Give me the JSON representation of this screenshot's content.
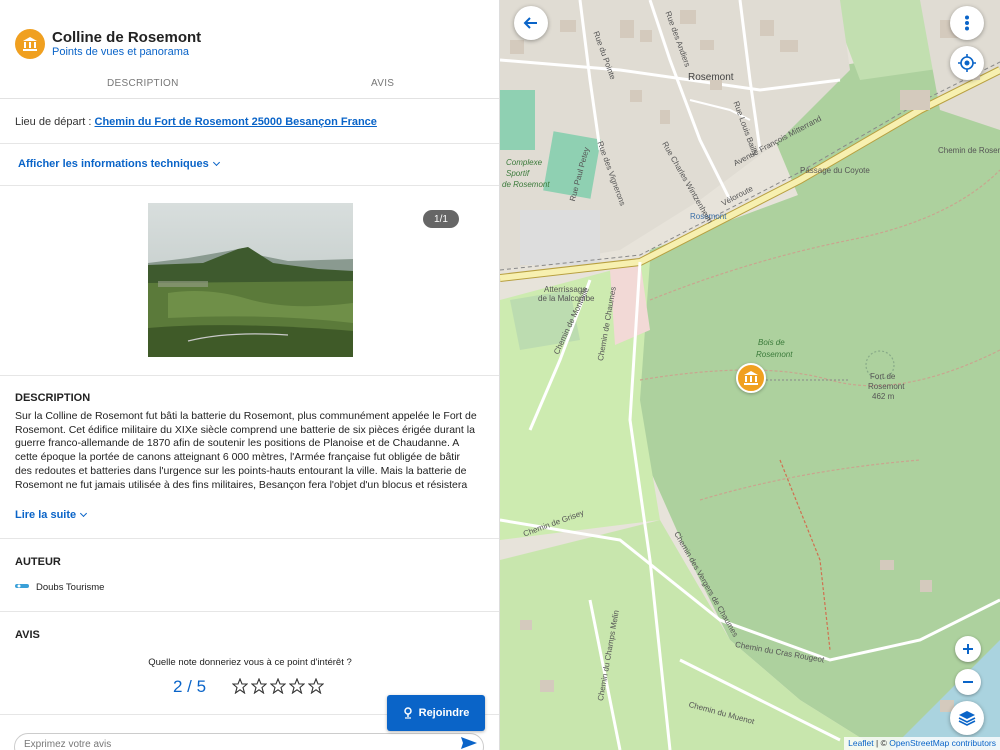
{
  "header": {
    "title": "Colline de Rosemont",
    "subtitle": "Points de vues et panorama",
    "icon": "monument-icon",
    "accent_color": "#f0a020"
  },
  "tabs": [
    "DESCRIPTION",
    "AVIS"
  ],
  "depart": {
    "label": "Lieu de départ :",
    "link": "Chemin du Fort de Rosemont 25000 Besançon France"
  },
  "tech_toggle": "Afficher les informations techniques",
  "gallery": {
    "counter": "1/1"
  },
  "description": {
    "heading": "DESCRIPTION",
    "text": "Sur la Colline de Rosemont fut bâti la batterie du Rosemont, plus communément appelée le Fort de Rosemont. Cet édifice militaire du XIXe siècle comprend une batterie de six pièces érigée durant la guerre franco-allemande de 1870 afin de soutenir les positions de Planoise et de Chaudanne. A cette époque la portée de canons atteignant 6 000 mètres, l'Armée française fut obligée de bâtir des redoutes et batteries dans l'urgence sur les points-hauts entourant la ville. Mais la batterie de Rosemont ne fut jamais utilisée à des fins militaires, Besançon fera l'objet d'un blocus et résistera",
    "read_more": "Lire la suite"
  },
  "author": {
    "heading": "AUTEUR",
    "name": "Doubs Tourisme"
  },
  "reviews": {
    "heading": "AVIS",
    "question": "Quelle note donneriez vous à ce point d'intérêt ?",
    "score": "2 / 5",
    "rating_value": 2,
    "rating_max": 5,
    "comment_placeholder": "Exprimez votre avis"
  },
  "join_button": "Rejoindre",
  "map": {
    "labels": {
      "rosemont": "Rosemont",
      "bois": "Bois de",
      "bois2": "Rosemont",
      "fort": "Fort de",
      "fort2": "Rosemont",
      "fort_alt": "462 m",
      "complexe": "Complexe",
      "sportif": "Sportif",
      "de_rosemont": "de Rosemont",
      "atterrissage": "Atterrissage",
      "malcombe": "de la Malcombe",
      "ch_chaumes": "Chemin de Chaumes",
      "ch_montoille": "Chemin de Montoille",
      "ch_grisey": "Chemin de Grisey",
      "ch_cras": "Chemin du Cras Rougeot",
      "ch_champs": "Chemin du Champs Melin",
      "ch_muenot": "Chemin du Muenot",
      "ch_vergers": "Chemin des Vergers de Chaumes",
      "av_mitterrand": "Avenue François Mitterrand",
      "ch_rosemont": "Chemin de Rosemont",
      "coyote": "Passage du Coyote",
      "velo": "Véloroute",
      "bus": "Rosemont",
      "rue_paul": "Rue Paul Petey",
      "rue_vignerons": "Rue des Vignerons",
      "rue_mitterrand": "Rue Charles Wintzenheim",
      "rue_andiers": "Rue des Andiers",
      "rue_louis": "Rue Louis Bailly",
      "rue_pointe": "Rue du Pointe"
    },
    "attribution_leaflet": "Leaflet",
    "attribution_sep": " | © ",
    "attribution_osm": "OpenStreetMap contributors"
  }
}
